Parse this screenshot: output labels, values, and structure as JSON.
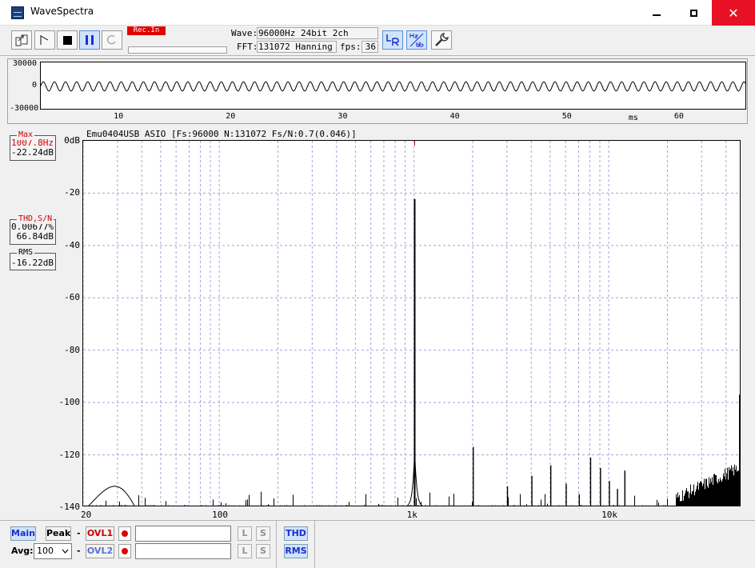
{
  "window": {
    "title": "WaveSpectra",
    "close_glyph": "✕"
  },
  "toolbar": {
    "rec_label": "Rec.In",
    "wave_label": "Wave:",
    "wave_value": "96000Hz 24bit 2ch",
    "fft_label": "FFT:",
    "fft_value": "131072 Hanning",
    "fps_label": "fps:",
    "fps_value": "36",
    "icons": [
      "open-file-icon",
      "play-marker-icon",
      "stop-icon",
      "pause-icon",
      "loop-icon",
      "lr-channel-icon",
      "hz-db-scale-icon",
      "settings-wrench-icon"
    ]
  },
  "waveform": {
    "y_labels": [
      "30000",
      "0",
      "-30000"
    ],
    "x_labels": [
      "10",
      "20",
      "30",
      "40",
      "50",
      "60"
    ],
    "x_unit": "ms",
    "x_range_ms": [
      3,
      66
    ],
    "y_range": [
      -30000,
      30000
    ],
    "signal_hz": 1007.8,
    "amplitude": 3000
  },
  "spectrum": {
    "header": "Emu0404USB ASIO  [Fs:96000 N:131072 Fs/N:0.7(0.046)]",
    "y_labels": [
      "0dB",
      "-20",
      "-40",
      "-60",
      "-80",
      "-100",
      "-120",
      "-140"
    ],
    "x_labels": [
      "20",
      "100",
      "1k",
      "10k"
    ],
    "x_range_hz": [
      20,
      48000
    ],
    "y_range_db": [
      -140,
      0
    ],
    "max": {
      "title": "Max",
      "freq": "1007.8Hz",
      "level": "-22.24dB"
    },
    "thd": {
      "title": "THD,S/N",
      "thd": "0.00677%",
      "sn": "66.84dB"
    },
    "rms": {
      "title": "RMS",
      "value": "-16.22dB"
    },
    "fundamental": {
      "freq": 1007.8,
      "db": -22.24
    },
    "harmonics": [
      {
        "freq": 2015,
        "db": -117
      },
      {
        "freq": 3020,
        "db": -132
      },
      {
        "freq": 4030,
        "db": -128
      },
      {
        "freq": 5040,
        "db": -124
      },
      {
        "freq": 6050,
        "db": -131
      },
      {
        "freq": 7060,
        "db": -135
      },
      {
        "freq": 8070,
        "db": -121
      },
      {
        "freq": 9070,
        "db": -125
      },
      {
        "freq": 10080,
        "db": -130
      },
      {
        "freq": 11090,
        "db": -133
      },
      {
        "freq": 12100,
        "db": -126
      },
      {
        "freq": 47000,
        "db": -97
      }
    ]
  },
  "bottom": {
    "main_label": "Main",
    "peak_label": "Peak",
    "dash": "-",
    "ovl1_label": "OVL1",
    "ovl2_label": "OVL2",
    "avg_label": "Avg:",
    "avg_value": "100",
    "l_label": "L",
    "s_label": "S",
    "thd_label": "THD",
    "rms_label": "RMS"
  },
  "colors": {
    "grid": "#9ea6d8",
    "red": "#e00000",
    "ovl1": "#d00000",
    "ovl2": "#5a6fd6",
    "button_bg": "#cfe3fb"
  }
}
